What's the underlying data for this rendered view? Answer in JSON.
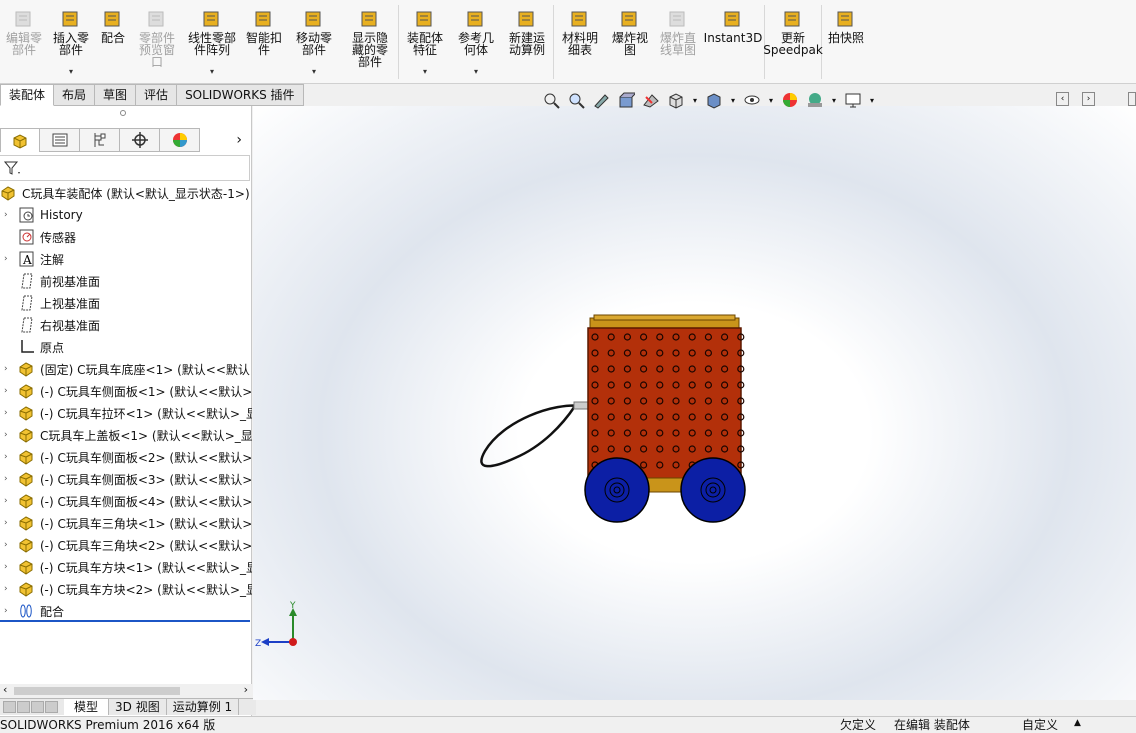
{
  "ribbon": {
    "buttons": [
      {
        "label": "编辑零\n部件",
        "disabled": true
      },
      {
        "label": "插入零\n部件",
        "disabled": false
      },
      {
        "label": "配合",
        "disabled": false
      },
      {
        "label": "零部件\n预览窗\n口",
        "disabled": true
      },
      {
        "label": "线性零部\n件阵列",
        "disabled": false
      },
      {
        "label": "智能扣\n件",
        "disabled": false
      },
      {
        "label": "移动零\n部件",
        "disabled": false
      },
      {
        "label": "显示隐\n藏的零\n部件",
        "disabled": false
      },
      {
        "label": "装配体\n特征",
        "disabled": false
      },
      {
        "label": "参考几\n何体",
        "disabled": false
      },
      {
        "label": "新建运\n动算例",
        "disabled": false
      },
      {
        "label": "材料明\n细表",
        "disabled": false
      },
      {
        "label": "爆炸视\n图",
        "disabled": false
      },
      {
        "label": "爆炸直\n线草图",
        "disabled": true
      },
      {
        "label": "Instant3D",
        "disabled": false
      },
      {
        "label": "更新\nSpeedpak",
        "disabled": false
      },
      {
        "label": "拍快照",
        "disabled": false
      }
    ]
  },
  "tabs": [
    "装配体",
    "布局",
    "草图",
    "评估",
    "SOLIDWORKS 插件"
  ],
  "tree": {
    "root": "C玩具车装配体 (默认<默认_显示状态-1>)",
    "items": [
      {
        "label": "History",
        "icon": "history-icon",
        "expand": true
      },
      {
        "label": "传感器",
        "icon": "sensor-icon",
        "expand": false
      },
      {
        "label": "注解",
        "icon": "annotation-icon",
        "expand": true
      },
      {
        "label": "前视基准面",
        "icon": "plane-icon",
        "expand": false
      },
      {
        "label": "上视基准面",
        "icon": "plane-icon",
        "expand": false
      },
      {
        "label": "右视基准面",
        "icon": "plane-icon",
        "expand": false
      },
      {
        "label": "原点",
        "icon": "origin-icon",
        "expand": false
      },
      {
        "label": "(固定) C玩具车底座<1> (默认<<默认",
        "icon": "part-icon",
        "expand": true
      },
      {
        "label": "(-) C玩具车侧面板<1> (默认<<默认>",
        "icon": "part-icon",
        "expand": true
      },
      {
        "label": "(-) C玩具车拉环<1> (默认<<默认>_显",
        "icon": "part-icon",
        "expand": true
      },
      {
        "label": "C玩具车上盖板<1> (默认<<默认>_显",
        "icon": "part-icon",
        "expand": true
      },
      {
        "label": "(-) C玩具车侧面板<2> (默认<<默认>",
        "icon": "part-icon",
        "expand": true
      },
      {
        "label": "(-) C玩具车侧面板<3> (默认<<默认>",
        "icon": "part-icon",
        "expand": true
      },
      {
        "label": "(-) C玩具车侧面板<4> (默认<<默认>",
        "icon": "part-icon",
        "expand": true
      },
      {
        "label": "(-) C玩具车三角块<1> (默认<<默认>",
        "icon": "part-icon",
        "expand": true
      },
      {
        "label": "(-) C玩具车三角块<2> (默认<<默认>",
        "icon": "part-icon",
        "expand": true
      },
      {
        "label": "(-) C玩具车方块<1> (默认<<默认>_显",
        "icon": "part-icon",
        "expand": true
      },
      {
        "label": "(-) C玩具车方块<2> (默认<<默认>_显",
        "icon": "part-icon",
        "expand": true
      },
      {
        "label": "配合",
        "icon": "mates-icon",
        "expand": true
      }
    ]
  },
  "bottom_tabs": [
    "模型",
    "3D 视图",
    "运动算例 1"
  ],
  "status": {
    "left": "SOLIDWORKS Premium 2016 x64 版",
    "undefined": "欠定义",
    "editing": "在编辑 装配体",
    "custom": "自定义"
  },
  "triad": {
    "x": "Z",
    "y": "Y"
  }
}
